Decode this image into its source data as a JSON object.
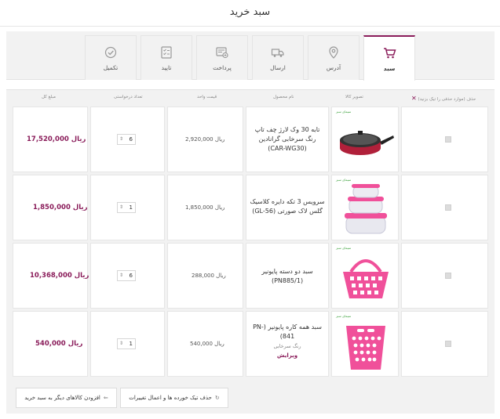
{
  "page": {
    "title": "سبد خرید"
  },
  "steps": [
    {
      "label": "سبد",
      "icon": "cart-icon",
      "active": true
    },
    {
      "label": "آدرس",
      "icon": "location-pin-icon",
      "active": false
    },
    {
      "label": "ارسال",
      "icon": "truck-icon",
      "active": false
    },
    {
      "label": "پرداخت",
      "icon": "payment-icon",
      "active": false
    },
    {
      "label": "تایید",
      "icon": "checklist-icon",
      "active": false
    },
    {
      "label": "تکمیل",
      "icon": "check-circle-icon",
      "active": false
    }
  ],
  "table": {
    "headers": {
      "delete": "حذف (موارد حذفی را تیک بزنید)",
      "image": "تصویر کالا",
      "name": "نام محصول",
      "unit_price": "قیمت واحد",
      "quantity": "تعداد درخواستی",
      "total": "مبلغ کل"
    },
    "brand_label": "سیمای سبز",
    "rows": [
      {
        "name": "تابه 30 وک لارژ چف تاپ رنگ سرخابی گرانادین (CAR-WG30)",
        "unit_price": "2,920,000 ریال",
        "quantity": "6",
        "total": "17,520,000 ریال",
        "image_icon": "frying-pan-icon"
      },
      {
        "name": "سرویس 3 تکه دایره کلاسیک گلس لاک صورتی (GL-56)",
        "unit_price": "1,850,000 ریال",
        "quantity": "1",
        "total": "1,850,000 ریال",
        "image_icon": "glass-containers-icon"
      },
      {
        "name": "سبد دو دسته پایونیر (PN885/1)",
        "unit_price": "288,000 ریال",
        "quantity": "6",
        "total": "10,368,000 ریال",
        "image_icon": "basket-icon"
      },
      {
        "name": "سبد همه کاره پایونیر (PN-841)",
        "sub": "رنگ سرخابی",
        "edit": "ویرایش",
        "unit_price": "540,000 ریال",
        "quantity": "1",
        "total": "540,000 ریال",
        "image_icon": "laundry-basket-icon"
      }
    ]
  },
  "actions": {
    "delete_update": "حذف تیک خورده ها و اعمال تغییرات",
    "add_more": "افزودن کالاهای دیگر به سبد خرید"
  },
  "colors": {
    "accent": "#8a1c5a",
    "product_pink": "#f0509a",
    "pan_red": "#b0203a"
  }
}
